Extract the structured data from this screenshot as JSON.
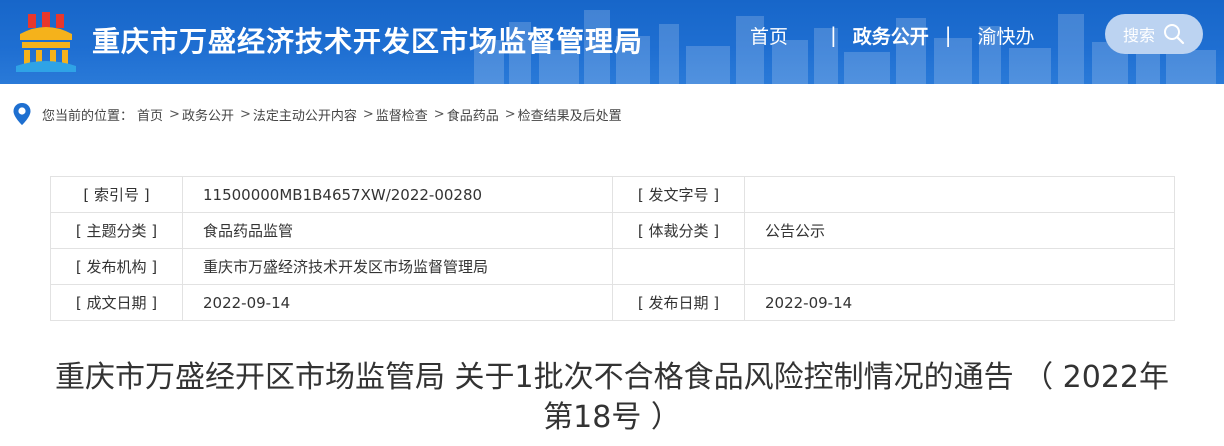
{
  "header": {
    "site_title": "重庆市万盛经济技术开发区市场监督管理局",
    "nav": [
      "首页",
      "政务公开",
      "渝快办"
    ],
    "nav_sep": "|",
    "search_label": "搜索"
  },
  "breadcrumb": {
    "prefix": "您当前的位置：",
    "items": [
      "首页",
      "政务公开",
      "法定主动公开内容",
      "监督检查",
      "食品药品",
      "检查结果及后处置"
    ],
    "sep": ">"
  },
  "info": {
    "rows": [
      [
        "[ 索引号 ]",
        "11500000MB1B4657XW/2022-00280",
        "[ 发文字号 ]",
        ""
      ],
      [
        "[ 主题分类 ]",
        "食品药品监管",
        "[ 体裁分类 ]",
        "公告公示"
      ],
      [
        "[ 发布机构 ]",
        "重庆市万盛经济技术开发区市场监督管理局",
        "",
        ""
      ],
      [
        "[ 成文日期 ]",
        "2022-09-14",
        "[ 发布日期 ]",
        "2022-09-14"
      ]
    ]
  },
  "article": {
    "title": "重庆市万盛经开区市场监管局 关于1批次不合格食品风险控制情况的通告 （ 2022年第18号 ）"
  },
  "colors": {
    "header_bg": "#1f6fd2",
    "search_bg": "#bcd3f1",
    "pin": "#1e6fd0"
  }
}
